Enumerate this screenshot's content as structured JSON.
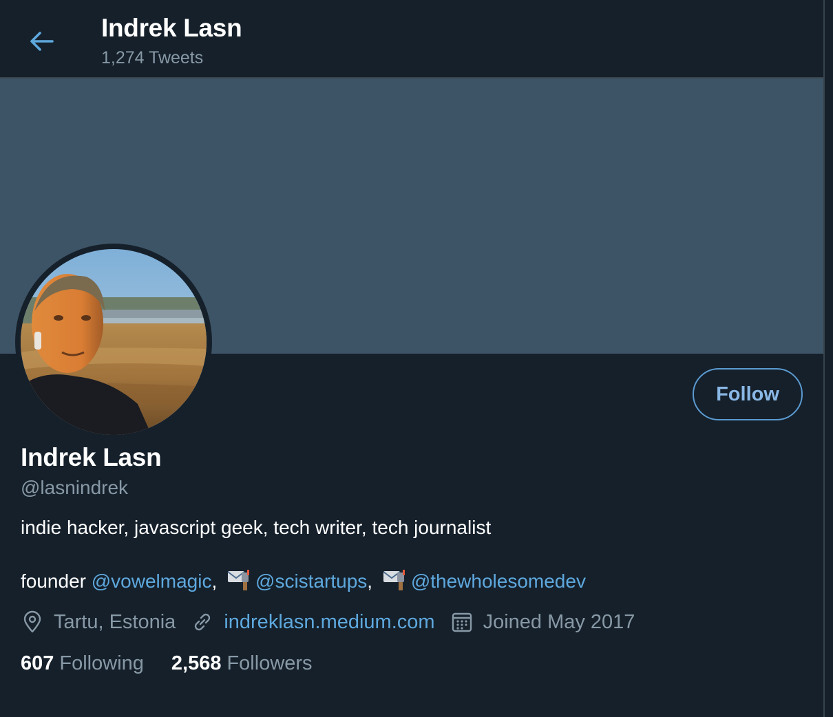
{
  "header": {
    "title": "Indrek Lasn",
    "tweet_count": "1,274 Tweets",
    "back_icon": "arrow-left-icon"
  },
  "colors": {
    "background": "#15202b",
    "banner": "#3d5466",
    "accent": "#5ea8dd",
    "muted": "#8899a6"
  },
  "profile": {
    "name": "Indrek Lasn",
    "handle": "@lasnindrek",
    "follow_label": "Follow",
    "bio_line1": "indie hacker, javascript geek, tech writer, tech journalist",
    "bio_line2": {
      "prefix": "founder",
      "mention1": "@vowelmagic",
      "sep1": ",",
      "mention2": "@scistartups",
      "sep2": ",",
      "mention3": "@thewholesomedev"
    },
    "location": "Tartu, Estonia",
    "website": "indreklasn.medium.com",
    "joined": "Joined May 2017"
  },
  "stats": {
    "following_count": "607",
    "following_label": "Following",
    "followers_count": "2,568",
    "followers_label": "Followers"
  }
}
